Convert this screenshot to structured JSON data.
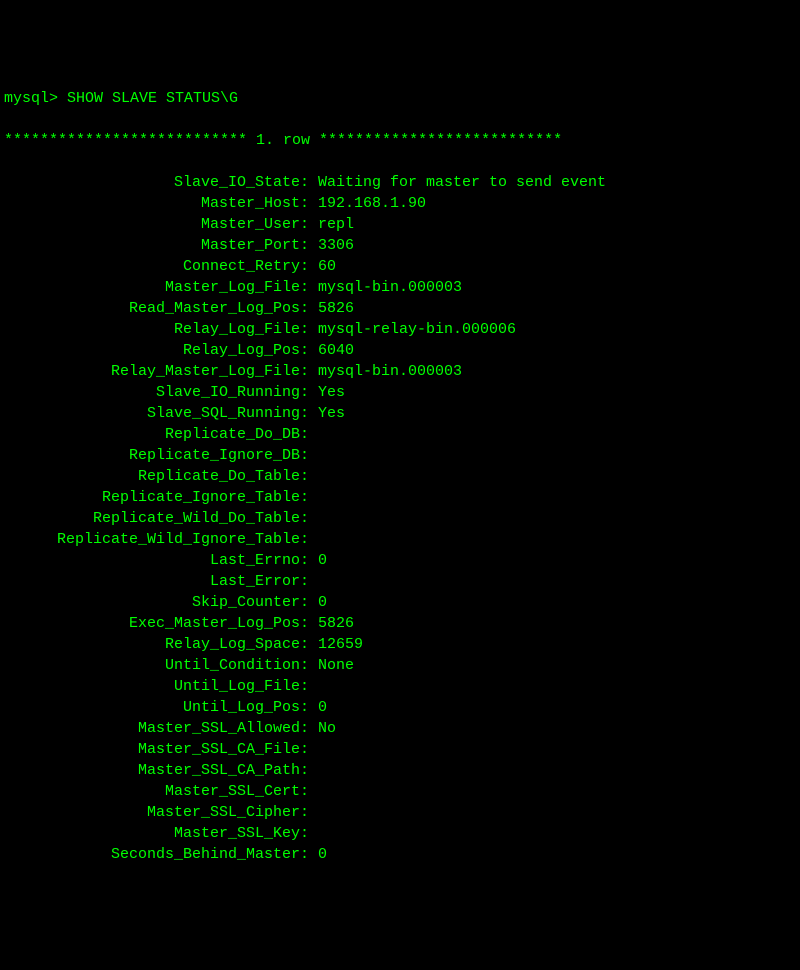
{
  "prompt": "mysql> ",
  "command": "SHOW SLAVE STATUS\\G",
  "row_separator": "*************************** 1. row ***************************",
  "fields": [
    {
      "label": "Slave_IO_State",
      "value": "Waiting for master to send event"
    },
    {
      "label": "Master_Host",
      "value": "192.168.1.90"
    },
    {
      "label": "Master_User",
      "value": "repl"
    },
    {
      "label": "Master_Port",
      "value": "3306"
    },
    {
      "label": "Connect_Retry",
      "value": "60"
    },
    {
      "label": "Master_Log_File",
      "value": "mysql-bin.000003"
    },
    {
      "label": "Read_Master_Log_Pos",
      "value": "5826"
    },
    {
      "label": "Relay_Log_File",
      "value": "mysql-relay-bin.000006"
    },
    {
      "label": "Relay_Log_Pos",
      "value": "6040"
    },
    {
      "label": "Relay_Master_Log_File",
      "value": "mysql-bin.000003"
    },
    {
      "label": "Slave_IO_Running",
      "value": "Yes"
    },
    {
      "label": "Slave_SQL_Running",
      "value": "Yes"
    },
    {
      "label": "Replicate_Do_DB",
      "value": ""
    },
    {
      "label": "Replicate_Ignore_DB",
      "value": ""
    },
    {
      "label": "Replicate_Do_Table",
      "value": ""
    },
    {
      "label": "Replicate_Ignore_Table",
      "value": ""
    },
    {
      "label": "Replicate_Wild_Do_Table",
      "value": ""
    },
    {
      "label": "Replicate_Wild_Ignore_Table",
      "value": ""
    },
    {
      "label": "Last_Errno",
      "value": "0"
    },
    {
      "label": "Last_Error",
      "value": ""
    },
    {
      "label": "Skip_Counter",
      "value": "0"
    },
    {
      "label": "Exec_Master_Log_Pos",
      "value": "5826"
    },
    {
      "label": "Relay_Log_Space",
      "value": "12659"
    },
    {
      "label": "Until_Condition",
      "value": "None"
    },
    {
      "label": "Until_Log_File",
      "value": ""
    },
    {
      "label": "Until_Log_Pos",
      "value": "0"
    },
    {
      "label": "Master_SSL_Allowed",
      "value": "No"
    },
    {
      "label": "Master_SSL_CA_File",
      "value": ""
    },
    {
      "label": "Master_SSL_CA_Path",
      "value": ""
    },
    {
      "label": "Master_SSL_Cert",
      "value": ""
    },
    {
      "label": "Master_SSL_Cipher",
      "value": ""
    },
    {
      "label": "Master_SSL_Key",
      "value": ""
    },
    {
      "label": "Seconds_Behind_Master",
      "value": "0"
    }
  ]
}
